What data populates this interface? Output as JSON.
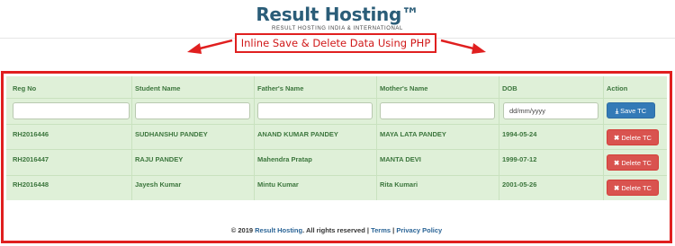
{
  "logo": {
    "title": "Result Hosting™",
    "subtitle": "RESULT HOSTING INDIA & INTERNATIONAL"
  },
  "banner": {
    "text": "Inline Save & Delete Data Using PHP"
  },
  "table": {
    "headers": [
      "Reg No",
      "Student Name",
      "Father's Name",
      "Mother's Name",
      "DOB",
      "Action"
    ],
    "dob_placeholder": "dd/mm/yyyy",
    "save_label": "Save TC",
    "delete_label": "Delete TC",
    "rows": [
      {
        "reg": "RH2016446",
        "student": "SUDHANSHU PANDEY",
        "father": "ANAND KUMAR PANDEY",
        "mother": "MAYA LATA PANDEY",
        "dob": "1994-05-24"
      },
      {
        "reg": "RH2016447",
        "student": "RAJU PANDEY",
        "father": "Mahendra Pratap",
        "mother": "MANTA DEVI",
        "dob": "1999-07-12"
      },
      {
        "reg": "RH2016448",
        "student": "Jayesh Kumar",
        "father": "Mintu Kumar",
        "mother": "Rita Kumari",
        "dob": "2001-05-26"
      }
    ]
  },
  "footer": {
    "copyright": "© 2019",
    "brand": "Result Hosting",
    "rights": ". All rights reserved |",
    "terms": "Terms",
    "sep": "|",
    "privacy": "Privacy Policy"
  },
  "colors": {
    "accent_red": "#e01f1f",
    "table_bg": "#dff0d8",
    "text_green": "#3c763d",
    "save_blue": "#337ab7",
    "delete_red": "#d9534f",
    "logo_blue": "#2b5d78"
  }
}
